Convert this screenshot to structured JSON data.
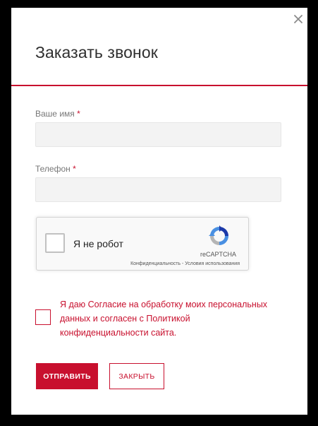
{
  "modal": {
    "title": "Заказать звонок",
    "close_icon": "close-icon"
  },
  "form": {
    "name": {
      "label": "Ваше имя",
      "required_mark": "*",
      "value": "",
      "placeholder": ""
    },
    "phone": {
      "label": "Телефон",
      "required_mark": "*",
      "value": "",
      "placeholder": ""
    }
  },
  "captcha": {
    "label": "Я не робот",
    "brand": "reCAPTCHA",
    "links": "Конфиденциальность - Условия использования",
    "logo_icon": "recaptcha-logo-icon"
  },
  "consent": {
    "text": "Я даю Согласие на обработку моих персональных данных и согласен с Политикой конфиденциальности сайта.",
    "checked": false
  },
  "buttons": {
    "submit_label": "ОТПРАВИТЬ",
    "close_label": "ЗАКРЫТЬ"
  },
  "colors": {
    "accent": "#c8102e",
    "backdrop": "#000000",
    "field_bg": "#f3f3f3"
  }
}
